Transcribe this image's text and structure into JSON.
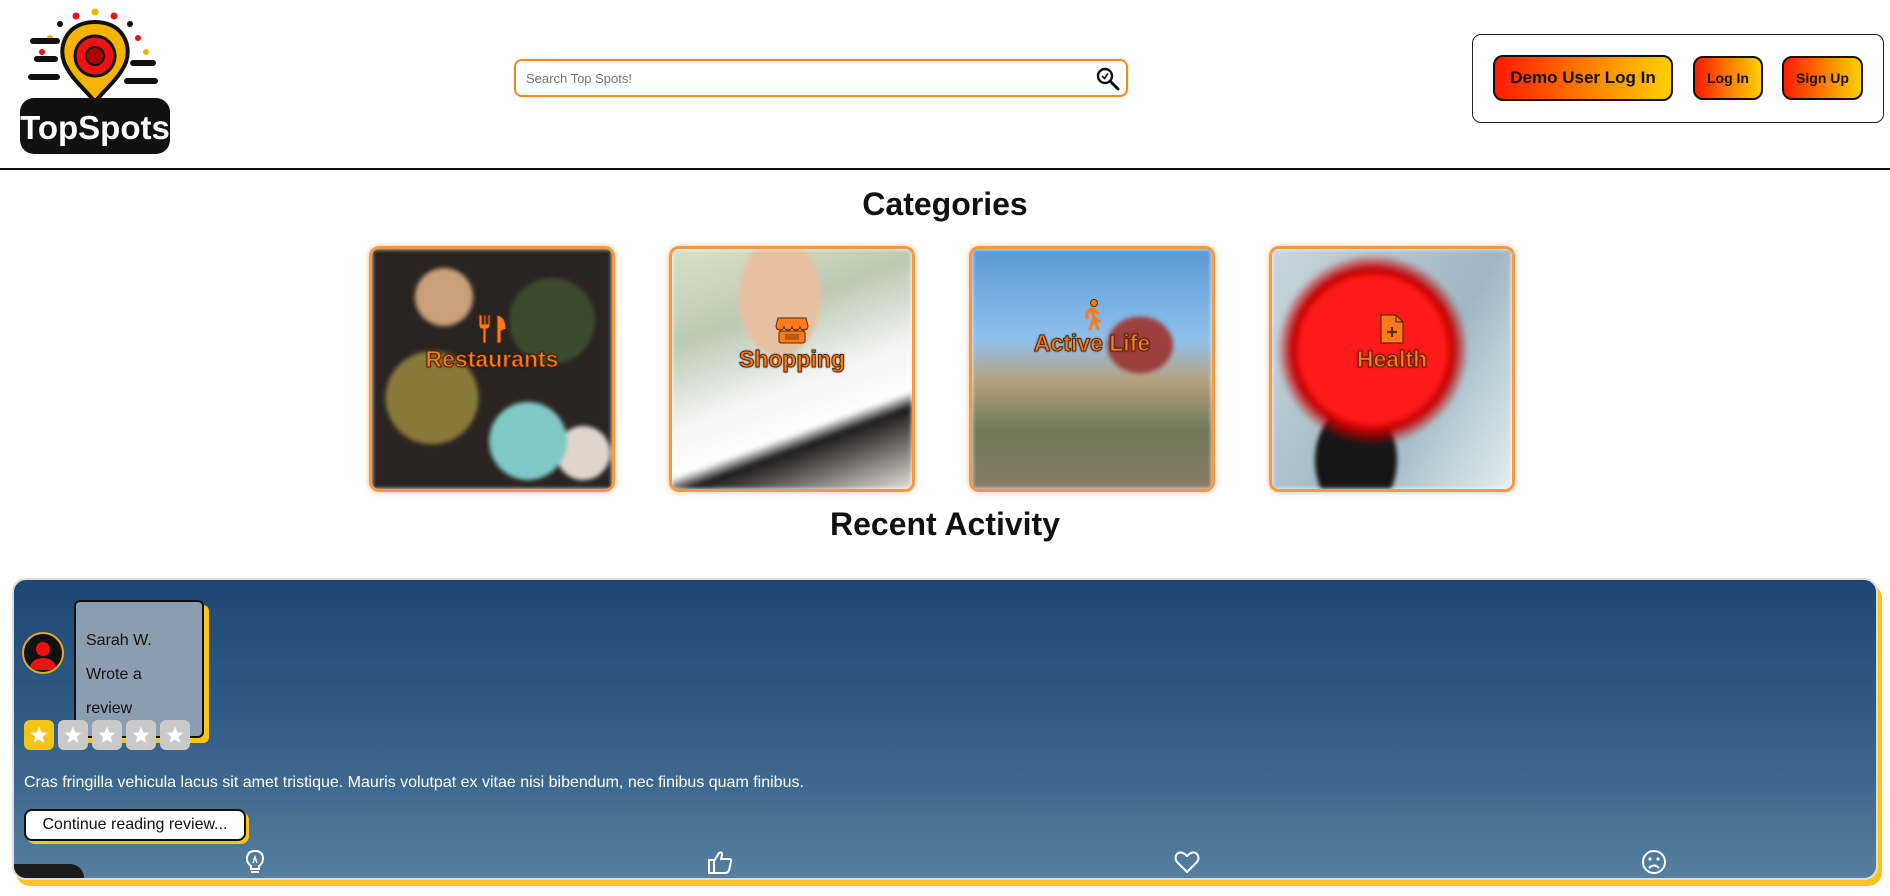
{
  "header": {
    "logo_text": "TopSpots",
    "search": {
      "placeholder": "Search Top Spots!"
    },
    "auth": {
      "demo_label": "Demo User Log In",
      "login_label": "Log In",
      "signup_label": "Sign Up"
    },
    "brand_colors": {
      "orange": "#f08a24",
      "red": "#ff1a00",
      "yellow": "#ffd000"
    }
  },
  "categories": {
    "title": "Categories",
    "items": [
      {
        "label": "Restaurants",
        "icon": "utensils-icon"
      },
      {
        "label": "Shopping",
        "icon": "store-icon"
      },
      {
        "label": "Active Life",
        "icon": "walking-person-icon"
      },
      {
        "label": "Health",
        "icon": "medical-file-icon"
      }
    ]
  },
  "recent_activity": {
    "title": "Recent Activity",
    "card": {
      "user_name": "Sarah W.",
      "action": "Wrote a review",
      "rating": 1,
      "rating_max": 5,
      "text": "Cras fringilla vehicula lacus sit amet tristique. Mauris volutpat ex vitae nisi bibendum, nec finibus quam finibus.",
      "continue_label": "Continue reading review...",
      "reactions": [
        "lightbulb-icon",
        "thumbs-up-icon",
        "heart-icon",
        "frown-icon"
      ]
    }
  }
}
